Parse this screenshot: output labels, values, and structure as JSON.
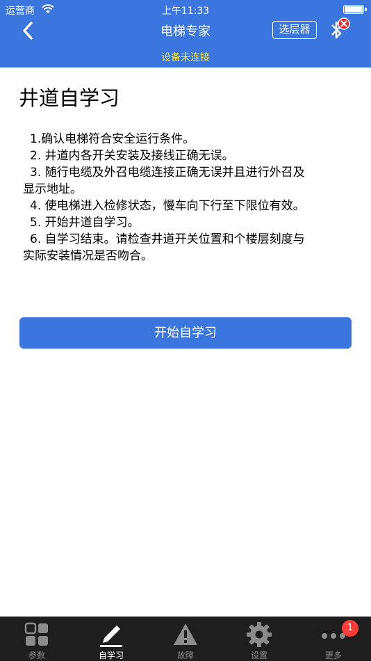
{
  "status_bar": {
    "carrier": "运营商",
    "time": "上午11:33"
  },
  "navbar": {
    "title": "电梯专家",
    "floor_selector_label": "选层器",
    "connection_status": "设备未连接"
  },
  "main": {
    "title": "井道自学习",
    "steps": [
      "1.确认电梯符合安全运行条件。",
      "2. 井道内各开关安装及接线正确无误。",
      "3. 随行电缆及外召电缆连接正确无误并且进行外召及",
      "显示地址。",
      "4. 使电梯进入检修状态，慢车向下行至下限位有效。",
      "5. 开始井道自学习。",
      "6. 自学习结束。请检查井道开关位置和个楼层刻度与",
      "实际安装情况是否吻合。"
    ],
    "start_button_label": "开始自学习"
  },
  "tabbar": {
    "tabs": [
      {
        "label": "参数",
        "icon": "grid-icon",
        "active": false
      },
      {
        "label": "自学习",
        "icon": "pencil-icon",
        "active": true
      },
      {
        "label": "故障",
        "icon": "warning-icon",
        "active": false
      },
      {
        "label": "设置",
        "icon": "gear-icon",
        "active": false
      },
      {
        "label": "更多",
        "icon": "more-dots-icon",
        "active": false
      }
    ],
    "more_badge": "1"
  },
  "colors": {
    "accent": "#3a76de",
    "warning_text": "#f4e640",
    "tabbar_bg": "#1e1e1e",
    "badge": "#fc3d39"
  }
}
